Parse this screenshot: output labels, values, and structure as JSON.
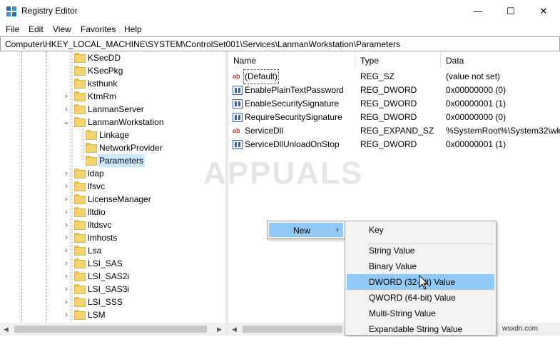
{
  "window": {
    "title": "Registry Editor",
    "minimize": "—",
    "maximize": "☐",
    "close": "✕"
  },
  "menu": [
    "File",
    "Edit",
    "View",
    "Favorites",
    "Help"
  ],
  "address": "Computer\\HKEY_LOCAL_MACHINE\\SYSTEM\\ControlSet001\\Services\\LanmanWorkstation\\Parameters",
  "tree": {
    "items": [
      {
        "label": "KSecDD",
        "expander": ""
      },
      {
        "label": "KSecPkg",
        "expander": ""
      },
      {
        "label": "ksthunk",
        "expander": ""
      },
      {
        "label": "KtmRm",
        "expander": "›"
      },
      {
        "label": "LanmanServer",
        "expander": "›"
      },
      {
        "label": "LanmanWorkstation",
        "expander": "⌄"
      },
      {
        "label": "Linkage",
        "expander": ""
      },
      {
        "label": "NetworkProvider",
        "expander": ""
      },
      {
        "label": "Parameters",
        "expander": ""
      },
      {
        "label": "ldap",
        "expander": "›"
      },
      {
        "label": "lfsvc",
        "expander": "›"
      },
      {
        "label": "LicenseManager",
        "expander": "›"
      },
      {
        "label": "lltdio",
        "expander": "›"
      },
      {
        "label": "lltdsvc",
        "expander": "›"
      },
      {
        "label": "lmhosts",
        "expander": "›"
      },
      {
        "label": "Lsa",
        "expander": "›"
      },
      {
        "label": "LSI_SAS",
        "expander": "›"
      },
      {
        "label": "LSI_SAS2i",
        "expander": "›"
      },
      {
        "label": "LSI_SAS3i",
        "expander": "›"
      },
      {
        "label": "LSI_SSS",
        "expander": "›"
      },
      {
        "label": "LSM",
        "expander": "›"
      }
    ],
    "selected": "Parameters"
  },
  "list": {
    "columns": [
      "Name",
      "Type",
      "Data"
    ],
    "rows": [
      {
        "icon": "string-value-icon",
        "name": "(Default)",
        "type": "REG_SZ",
        "data": "(value not set)"
      },
      {
        "icon": "binary-value-icon",
        "name": "EnablePlainTextPassword",
        "type": "REG_DWORD",
        "data": "0x00000000 (0)"
      },
      {
        "icon": "binary-value-icon",
        "name": "EnableSecuritySignature",
        "type": "REG_DWORD",
        "data": "0x00000001 (1)"
      },
      {
        "icon": "binary-value-icon",
        "name": "RequireSecuritySignature",
        "type": "REG_DWORD",
        "data": "0x00000000 (0)"
      },
      {
        "icon": "string-value-icon",
        "name": "ServiceDll",
        "type": "REG_EXPAND_SZ",
        "data": "%SystemRoot%\\System32\\wk"
      },
      {
        "icon": "binary-value-icon",
        "name": "ServiceDllUnloadOnStop",
        "type": "REG_DWORD",
        "data": "0x00000001 (1)"
      }
    ]
  },
  "context_menu": {
    "parent": {
      "label": "New",
      "arrow": "›"
    },
    "items": [
      {
        "label": "Key",
        "highlighted": false
      },
      {
        "label": "String Value",
        "highlighted": false
      },
      {
        "label": "Binary Value",
        "highlighted": false
      },
      {
        "label": "DWORD (32-bit) Value",
        "highlighted": true
      },
      {
        "label": "QWORD (64-bit) Value",
        "highlighted": false
      },
      {
        "label": "Multi-String Value",
        "highlighted": false
      },
      {
        "label": "Expandable String Value",
        "highlighted": false
      }
    ]
  },
  "watermark": "APPUALS",
  "site_tag": "wsxdn.com",
  "colors": {
    "selection": "#cce8ff",
    "menu_highlight": "#91c9f7",
    "folder": "#f3d472"
  }
}
